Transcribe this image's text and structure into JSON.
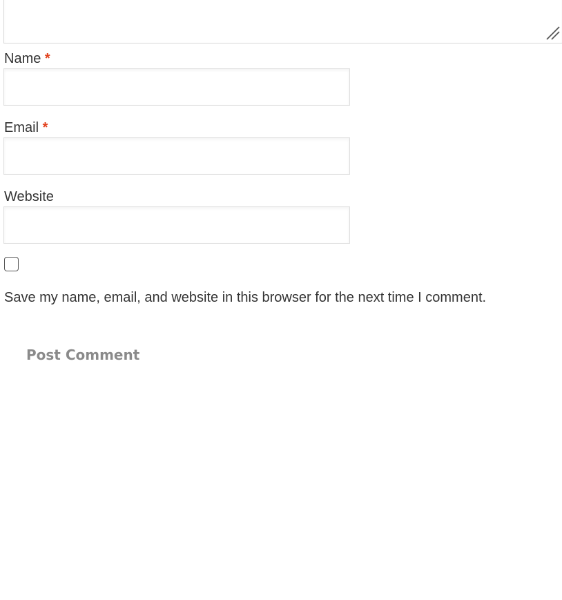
{
  "comment_form": {
    "fields": {
      "name": {
        "label": "Name",
        "required_marker": "*",
        "value": "",
        "placeholder": ""
      },
      "email": {
        "label": "Email",
        "required_marker": "*",
        "value": "",
        "placeholder": ""
      },
      "website": {
        "label": "Website",
        "value": "",
        "placeholder": ""
      }
    },
    "cookies_consent": {
      "checked": false,
      "label": "Save my name, email, and website in this browser for the next time I comment."
    },
    "submit_label": "Post Comment"
  },
  "colors": {
    "required": "#e2401c",
    "text": "#333333",
    "button_text": "#8a8a8a",
    "field_border": "#dedede"
  },
  "icons": {
    "resize": "resize-grip-icon"
  }
}
